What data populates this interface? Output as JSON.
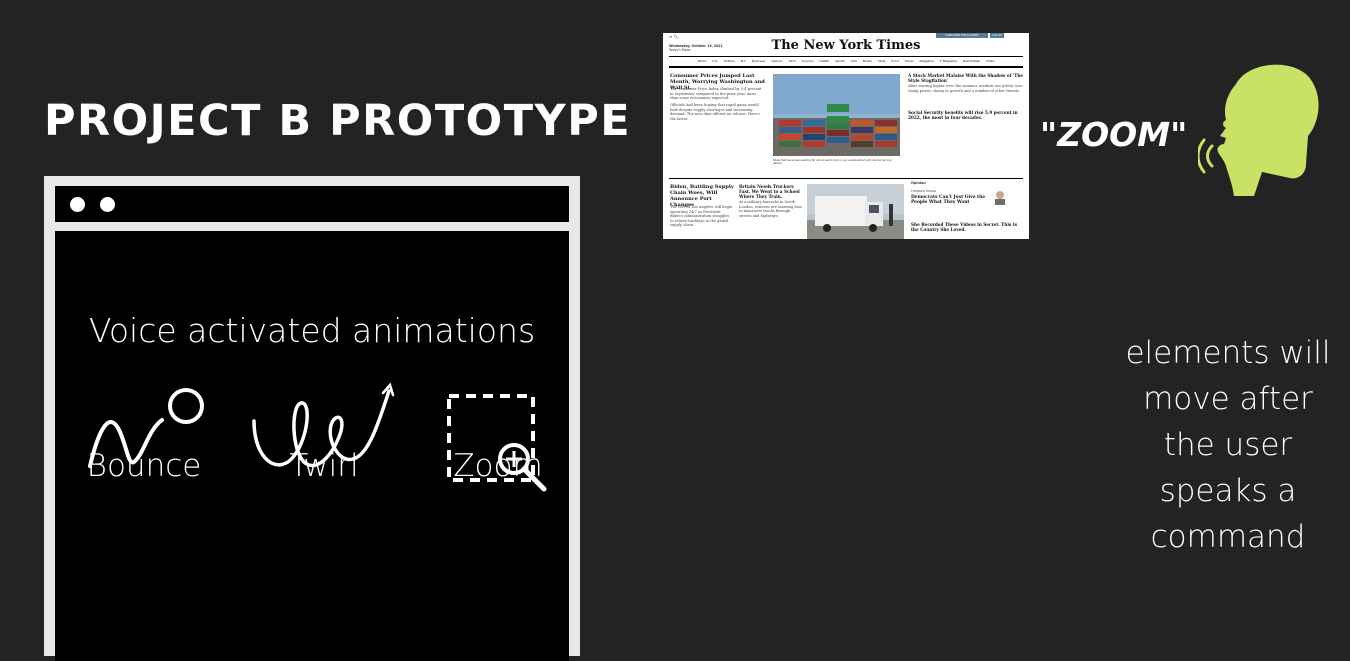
{
  "title": "PROJECT B PROTOTYPE",
  "phone": {
    "headline": "Voice activated animations",
    "animations": [
      {
        "label": "Bounce",
        "icon": "bounce-icon"
      },
      {
        "label": "Twirl",
        "icon": "twirl-icon"
      },
      {
        "label": "Zoom",
        "icon": "zoom-icon"
      }
    ]
  },
  "newspaper": {
    "logo": "The New York Times",
    "date": "Wednesday, October 13, 2021",
    "todays_paper": "Today's Paper",
    "subscribe_label": "SUBSCRIBE FOR $1/WEEK",
    "login_label": "LOG IN",
    "nav": [
      "World",
      "U.S.",
      "Politics",
      "N.Y.",
      "Business",
      "Opinion",
      "Tech",
      "Science",
      "Health",
      "Sports",
      "Arts",
      "Books",
      "Style",
      "Food",
      "Travel",
      "Magazine",
      "T Magazine",
      "Real Estate",
      "Video"
    ],
    "stories": {
      "lead_headline": "Consumer Prices Jumped Last Month, Worrying Washington and Wall St.",
      "lead_body_1": "The Consumer Price Index climbed by 5.4 percent in September compared to the prior year, more than some economists expected.",
      "lead_body_2": "Officials had been hoping that rapid gains would fade despite supply shortages and increasing demand. The new data offered no release. Here's the latest.",
      "right_headline_1": "A Stock Market Malaise With the Shadow of 'The Style Stagflation'",
      "right_body_1": "After soaring higher over the summer, markets are jittery over rising prices, slump in growth and a number of other threats.",
      "right_headline_2": "Social Security benefits will rise 5.9 percent in 2022, the most in four decades.",
      "caption": "Ships that have been waiting far out at sea to dock in an overwhelmed port are facing long delays.",
      "bottom_headline_1": "Biden, Battling Supply Chain Woes, Will Announce Port Changes",
      "bottom_body_1": "The Port of Los Angeles will begin operating 24/7 as President Biden's administration struggles to relieve backlogs in the global supply chain.",
      "bottom_headline_2": "Britain Needs Truckers Fast. We Went to a School Where They Train.",
      "bottom_body_2": "At a military barracks in South London, trainees are learning how to maneuver trucks through streets and highways.",
      "opinion_label": "Opinion",
      "opinion_author": "THOMAS B. EDSALL",
      "opinion_headline_1": "Democrats Can't Just Give the People What They Want",
      "opinion_headline_2": "She Recorded These Videos in Secret. This Is the Country She Loved."
    }
  },
  "quote": "\"ZOOM\"",
  "caption_lines": [
    "elements will",
    "move after",
    "the user",
    "speaks a",
    "command"
  ],
  "colors": {
    "background": "#222222",
    "accent_lime": "#c9e265",
    "phone_frame": "#e8e8e8"
  }
}
